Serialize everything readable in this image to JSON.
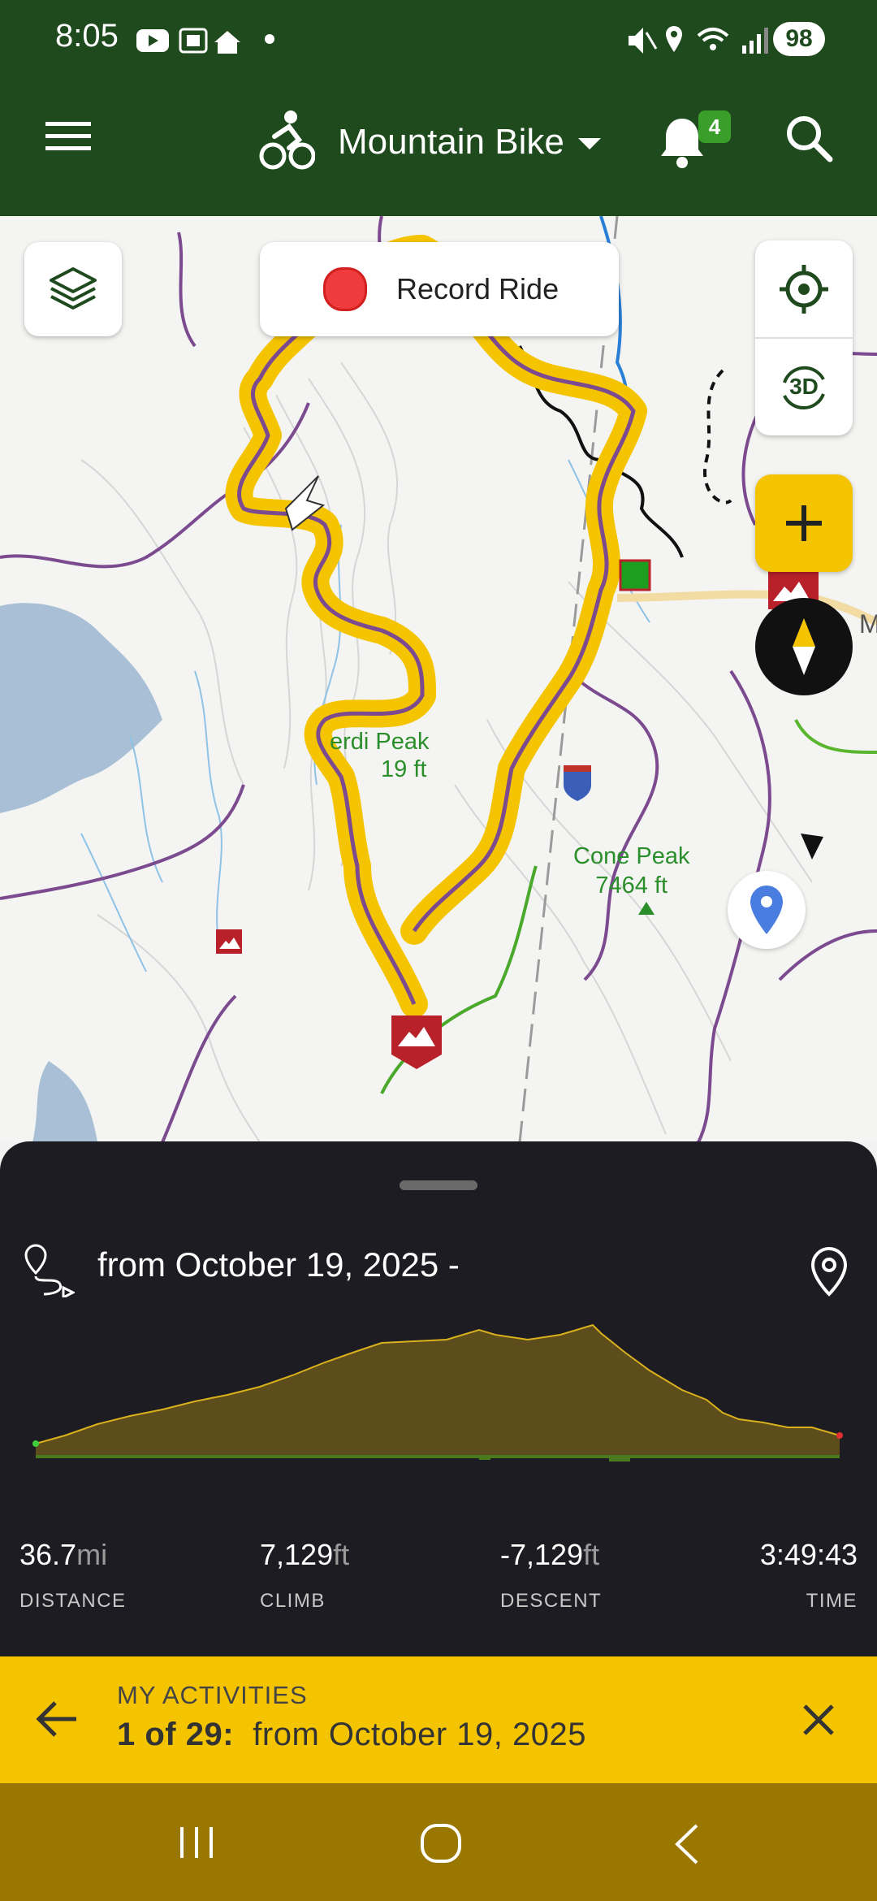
{
  "status_bar": {
    "time": "8:05",
    "battery": "98"
  },
  "app_bar": {
    "activity_type": "Mountain Bike",
    "notification_count": "4"
  },
  "map": {
    "record_button_label": "Record Ride",
    "three_d_label": "3D",
    "peak_labels": [
      {
        "name": "erdi Peak",
        "elevation": "19 ft"
      },
      {
        "name": "Cone Peak",
        "elevation": "7464 ft"
      }
    ],
    "edge_label": "M",
    "colors": {
      "route_highlight": "#f5c400",
      "track": "#7b4a8f",
      "start_marker": "#1e9e1e",
      "trailhead": "#b8202a",
      "water": "#a8bfd6"
    }
  },
  "activity_sheet": {
    "title": "from October 19, 2025 -",
    "elevation_chart": {
      "type": "area",
      "fill_color": "#5e4d1c",
      "stroke_color": "#d9b11c"
    },
    "stats": [
      {
        "value": "36.7",
        "unit": "mi",
        "label": "DISTANCE"
      },
      {
        "value": "7,129",
        "unit": "ft",
        "label": "CLIMB"
      },
      {
        "value": "-7,129",
        "unit": "ft",
        "label": "DESCENT"
      },
      {
        "value": "3:49:43",
        "unit": "",
        "label": "TIME"
      }
    ]
  },
  "banner": {
    "section_label": "MY ACTIVITIES",
    "position": "1 of 29:",
    "activity_name": "from October 19, 2025"
  }
}
